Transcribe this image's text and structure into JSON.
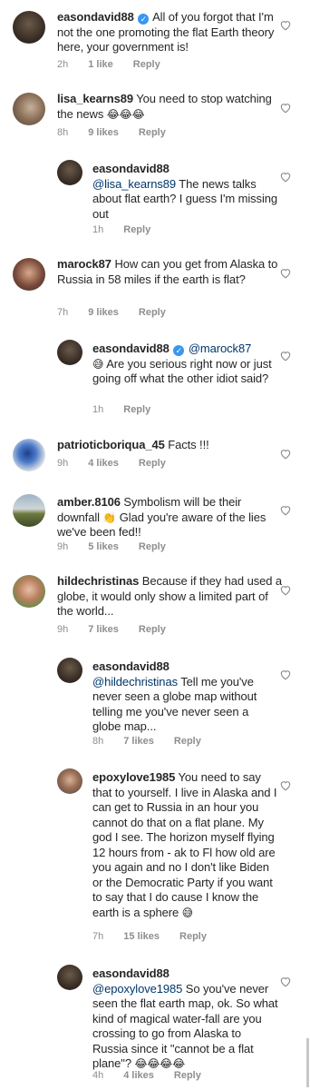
{
  "comments": [
    {
      "user": "easondavid88",
      "verified": true,
      "text": "All of you forgot that I'm not the one promoting the flat Earth theory here, your government is!",
      "time": "2h",
      "likes": "1 like",
      "reply": "Reply"
    },
    {
      "user": "lisa_kearns89",
      "text": "You need to stop watching the news",
      "emoji": "😂😂😂",
      "time": "8h",
      "likes": "9 likes",
      "reply": "Reply"
    },
    {
      "user": "easondavid88",
      "mention": "@lisa_kearns89",
      "text": "The news talks about flat earth? I guess I'm missing out",
      "time": "1h",
      "reply": "Reply"
    },
    {
      "user": "marock87",
      "text": "How can you get from Alaska to Russia in 58 miles if the earth is flat?",
      "time": "7h",
      "likes": "9 likes",
      "reply": "Reply"
    },
    {
      "user": "easondavid88",
      "verified": true,
      "mention": "@marock87",
      "emoji": "😅",
      "text": "Are you serious right now or just going off what the other idiot said?",
      "time": "1h",
      "reply": "Reply"
    },
    {
      "user": "patrioticboriqua_45",
      "text": "Facts !!!",
      "time": "9h",
      "likes": "4 likes",
      "reply": "Reply"
    },
    {
      "user": "amber.8106",
      "text": "Symbolism will be their downfall",
      "emoji": "👏",
      "text2": "Glad you're aware of the lies we've been fed!!",
      "time": "9h",
      "likes": "5 likes",
      "reply": "Reply"
    },
    {
      "user": "hildechristinas",
      "text": "Because if they had used a globe, it would only show a limited part of the world...",
      "time": "9h",
      "likes": "7 likes",
      "reply": "Reply"
    },
    {
      "user": "easondavid88",
      "mention": "@hildechristinas",
      "text": "Tell me you've never seen a globe map without telling me you've never seen a globe map...",
      "time": "8h",
      "likes": "7 likes",
      "reply": "Reply"
    },
    {
      "user": "epoxylove1985",
      "text": "You need to say that to yourself. I live in Alaska and I can get to Russia in an hour you cannot do that on a flat plane. My god I see. The horizon myself flying 12 hours from - ak to Fl how old are you again and no I don't like Biden or the Democratic Party if you want to say that I do cause I know the earth is a sphere",
      "emoji": "😅",
      "time": "7h",
      "likes": "15 likes",
      "reply": "Reply"
    },
    {
      "user": "easondavid88",
      "mention": "@epoxylove1985",
      "text": "So you've never seen the flat earth map, ok. So what kind of magical water-fall are you crossing to go from Alaska to Russia since it \"cannot be a flat plane\"?",
      "emoji": "😂😂😂😂",
      "time": "4h",
      "likes": "4 likes",
      "reply": "Reply"
    }
  ],
  "colors": {
    "text": "#262626",
    "meta": "#8e8e8e",
    "mention": "#00376b",
    "verified": "#3897f0"
  },
  "icons": {
    "like": "heart-outline-icon",
    "verified": "verified-badge-icon"
  }
}
